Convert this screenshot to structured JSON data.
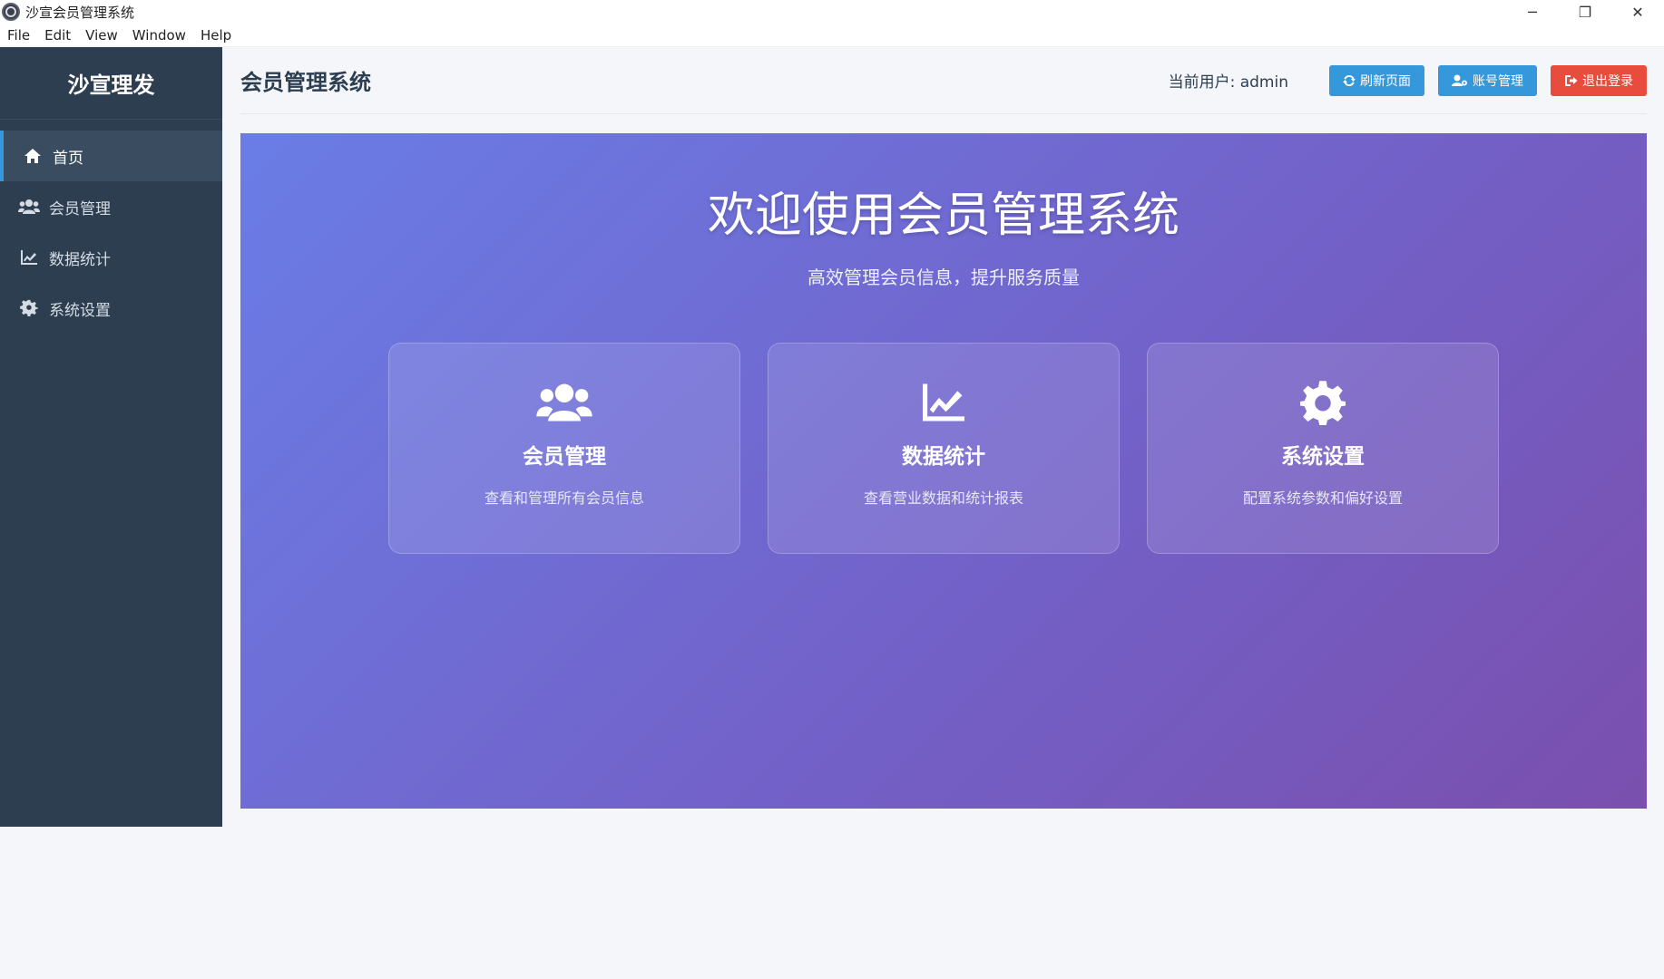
{
  "window": {
    "title": "沙宣会员管理系统",
    "controls": {
      "minimize": "─",
      "restore": "❐",
      "close": "✕"
    }
  },
  "menubar": {
    "items": [
      "File",
      "Edit",
      "View",
      "Window",
      "Help"
    ]
  },
  "sidebar": {
    "brand": "沙宣理发",
    "items": [
      {
        "label": "首页",
        "icon": "home-icon",
        "active": true
      },
      {
        "label": "会员管理",
        "icon": "users-icon",
        "active": false
      },
      {
        "label": "数据统计",
        "icon": "chart-line-icon",
        "active": false
      },
      {
        "label": "系统设置",
        "icon": "gear-icon",
        "active": false
      }
    ]
  },
  "header": {
    "title": "会员管理系统",
    "current_user": "当前用户: admin",
    "buttons": {
      "refresh": "刷新页面",
      "account": "账号管理",
      "logout": "退出登录"
    }
  },
  "hero": {
    "title": "欢迎使用会员管理系统",
    "subtitle": "高效管理会员信息，提升服务质量",
    "cards": [
      {
        "icon": "users-icon",
        "title": "会员管理",
        "desc": "查看和管理所有会员信息"
      },
      {
        "icon": "chart-line-icon",
        "title": "数据统计",
        "desc": "查看营业数据和统计报表"
      },
      {
        "icon": "gear-icon",
        "title": "系统设置",
        "desc": "配置系统参数和偏好设置"
      }
    ]
  },
  "colors": {
    "sidebar_bg": "#2d3e50",
    "accent_blue": "#3498db",
    "danger_red": "#e74c3c",
    "hero_gradient_start": "#6a7de6",
    "hero_gradient_end": "#7a4fae"
  }
}
